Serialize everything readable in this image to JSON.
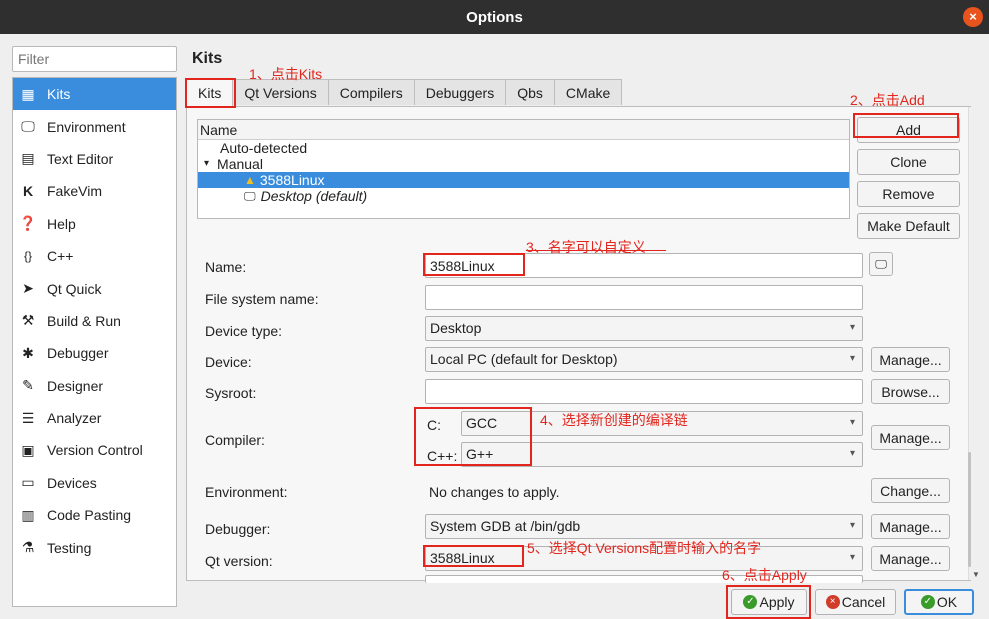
{
  "window": {
    "title": "Options",
    "close_glyph": "×"
  },
  "sidebar": {
    "filter_placeholder": "Filter",
    "items": [
      {
        "label": "Kits",
        "icon": "kits-icon"
      },
      {
        "label": "Environment",
        "icon": "monitor-icon"
      },
      {
        "label": "Text Editor",
        "icon": "text-editor-icon"
      },
      {
        "label": "FakeVim",
        "icon": "fakevim-icon"
      },
      {
        "label": "Help",
        "icon": "help-icon"
      },
      {
        "label": "C++",
        "icon": "braces-icon"
      },
      {
        "label": "Qt Quick",
        "icon": "paper-plane-icon"
      },
      {
        "label": "Build & Run",
        "icon": "hammer-icon"
      },
      {
        "label": "Debugger",
        "icon": "bug-icon"
      },
      {
        "label": "Designer",
        "icon": "pen-icon"
      },
      {
        "label": "Analyzer",
        "icon": "analyzer-icon"
      },
      {
        "label": "Version Control",
        "icon": "version-control-icon"
      },
      {
        "label": "Devices",
        "icon": "devices-icon"
      },
      {
        "label": "Code Pasting",
        "icon": "clipboard-icon"
      },
      {
        "label": "Testing",
        "icon": "testing-icon"
      }
    ]
  },
  "main": {
    "heading": "Kits",
    "tabs": [
      "Kits",
      "Qt Versions",
      "Compilers",
      "Debuggers",
      "Qbs",
      "CMake"
    ],
    "tree": {
      "header": "Name",
      "auto_detected": "Auto-detected",
      "manual": "Manual",
      "manual_expander": "▾",
      "kit_selected": "3588Linux",
      "kit_desktop": "Desktop (default)"
    },
    "buttons": {
      "add": "Add",
      "clone": "Clone",
      "remove": "Remove",
      "make_default": "Make Default"
    },
    "form": {
      "name_label": "Name:",
      "name_value": "3588Linux",
      "fs_name_label": "File system name:",
      "fs_name_value": "",
      "device_type_label": "Device type:",
      "device_type_value": "Desktop",
      "device_label": "Device:",
      "device_value": "Local PC (default for Desktop)",
      "sysroot_label": "Sysroot:",
      "sysroot_value": "",
      "compiler_label": "Compiler:",
      "c_label": "C:",
      "c_value": "GCC",
      "cxx_label": "C++:",
      "cxx_value": "G++",
      "environment_label": "Environment:",
      "environment_value": "No changes to apply.",
      "debugger_label": "Debugger:",
      "debugger_value": "System GDB at /bin/gdb",
      "qt_version_label": "Qt version:",
      "qt_version_value": "3588Linux",
      "manage": "Manage...",
      "browse": "Browse...",
      "change": "Change..."
    }
  },
  "annotations": {
    "a1": "1、点击Kits",
    "a2": "2、点击Add",
    "a3": "3、名字可以自定义",
    "a4": "4、选择新创建的编译链",
    "a5": "5、选择Qt Versions配置时输入的名字",
    "a6": "6、点击Apply"
  },
  "footer": {
    "apply": "Apply",
    "cancel": "Cancel",
    "ok": "OK"
  },
  "colors": {
    "accent": "#3a8ddd",
    "annotation": "#e2261d",
    "titlebar": "#2f2f2f"
  }
}
